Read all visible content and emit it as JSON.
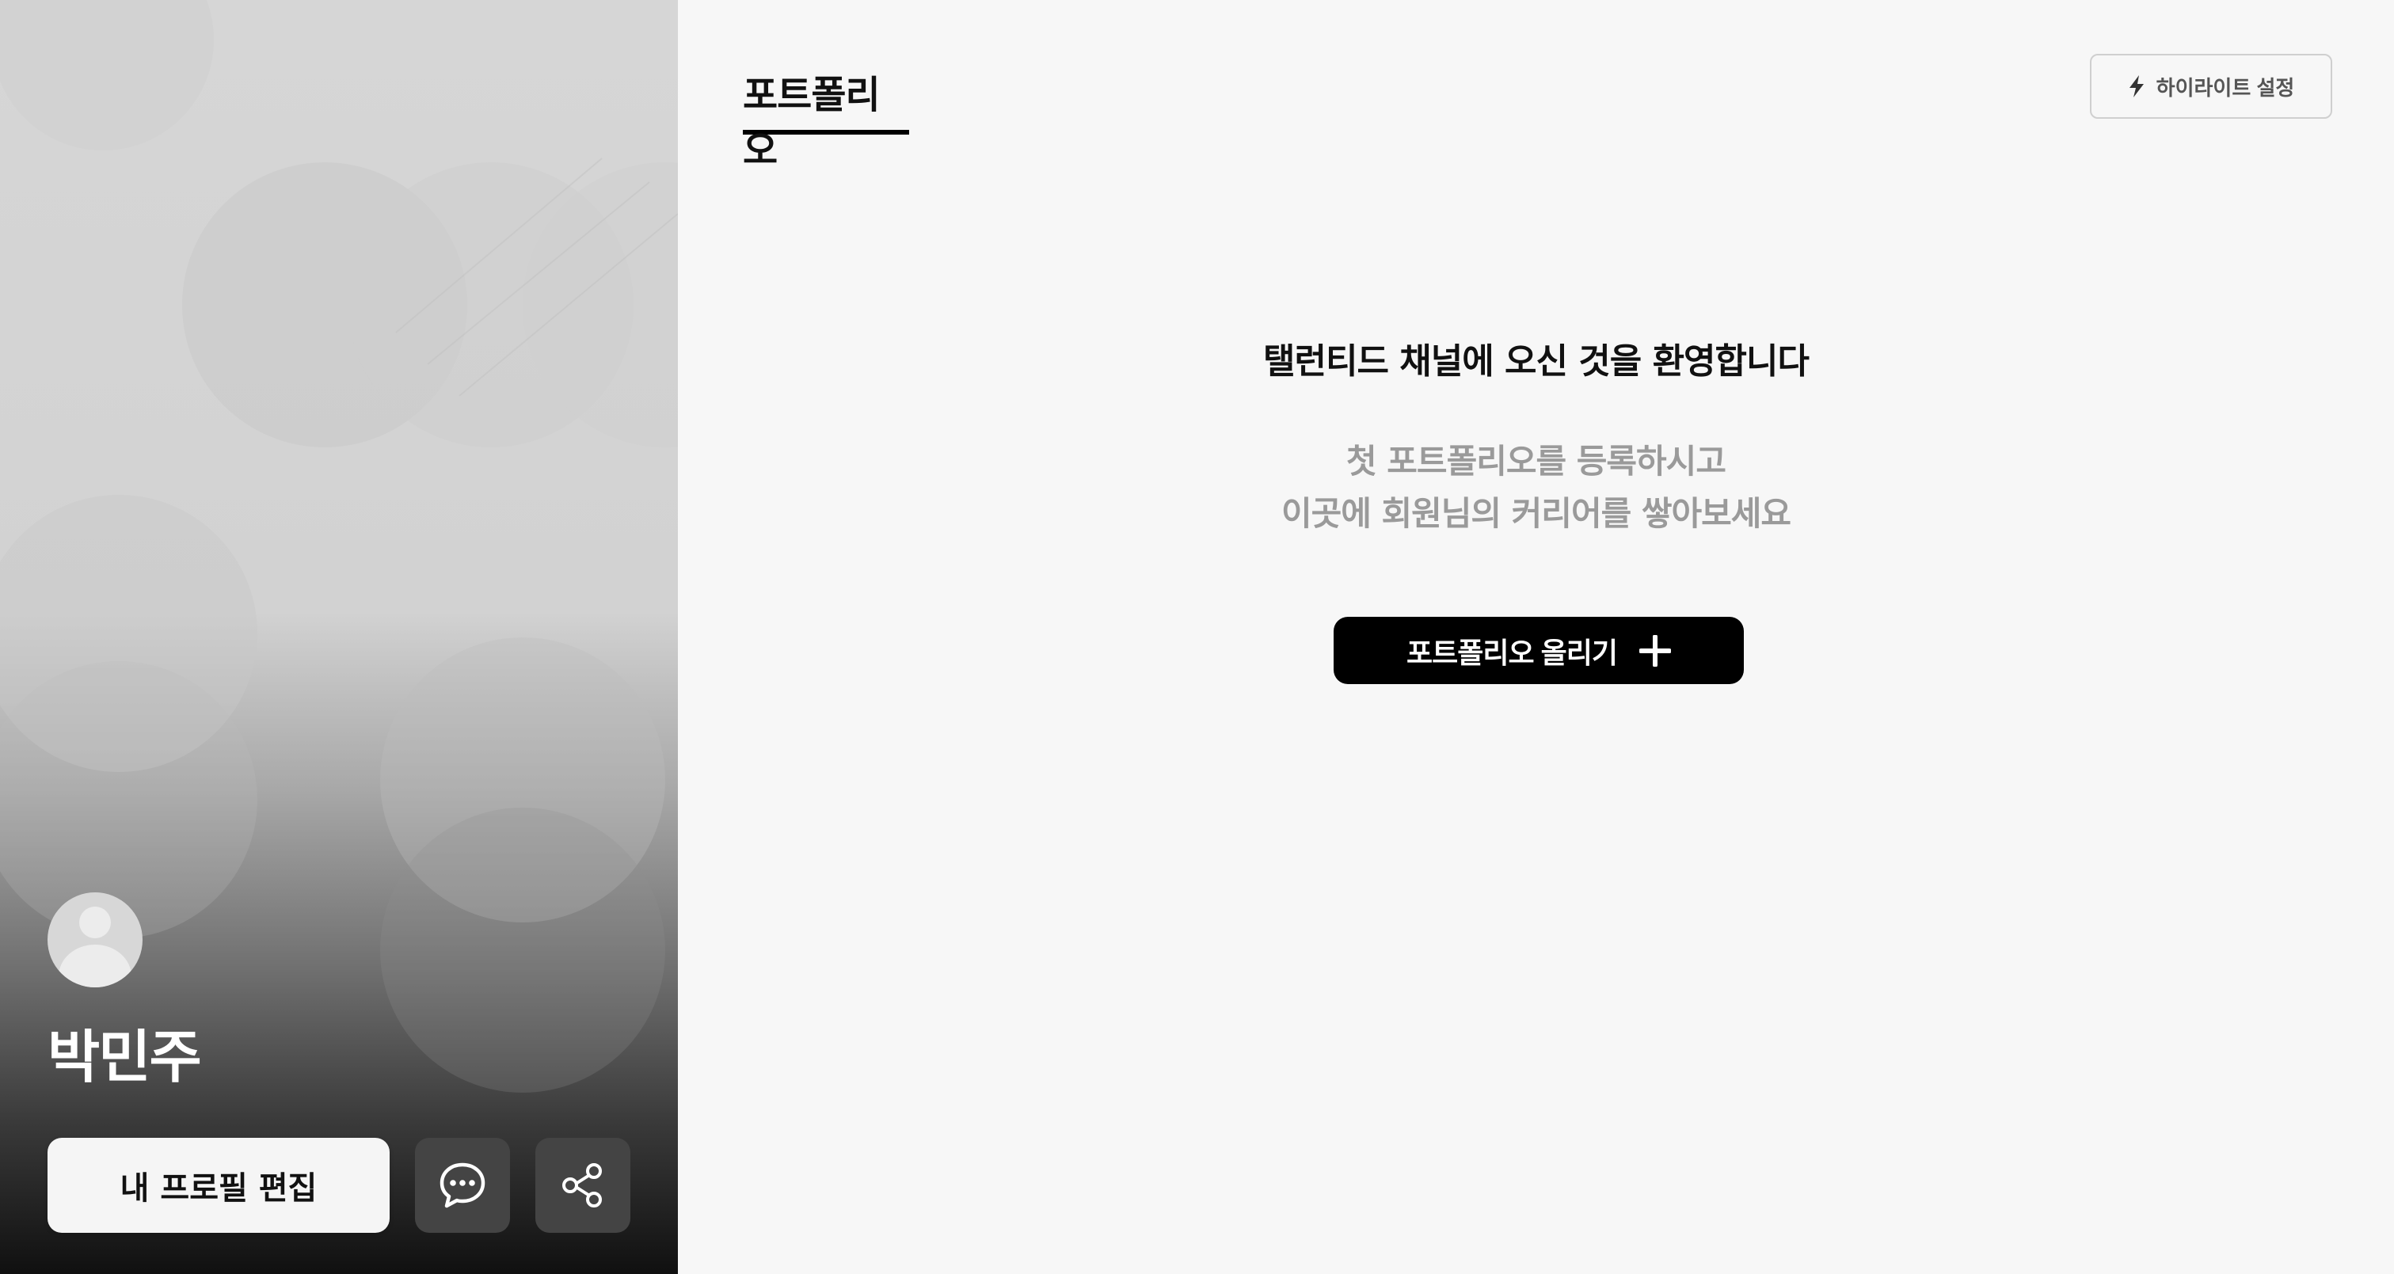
{
  "profile": {
    "name": "박민주",
    "edit_label": "내 프로필 편집",
    "icons": {
      "avatar": "user-avatar-icon",
      "message": "chat-bubble-icon",
      "share": "share-icon"
    }
  },
  "main": {
    "tabs": [
      {
        "label": "포트폴리오",
        "active": true
      }
    ],
    "highlight_button_label": "하이라이트 설정",
    "highlight_icon": "lightning-icon",
    "welcome_title": "탤런티드 채널에 오신 것을 환영합니다",
    "subtext_line1": "첫 포트폴리오를 등록하시고",
    "subtext_line2": "이곳에 회원님의 커리어를 쌓아보세요",
    "upload_label": "포트폴리오 올리기",
    "upload_icon": "plus-icon"
  },
  "colors": {
    "accent": "#000000",
    "muted_text": "#9a9a9a",
    "background": "#f7f7f7"
  }
}
